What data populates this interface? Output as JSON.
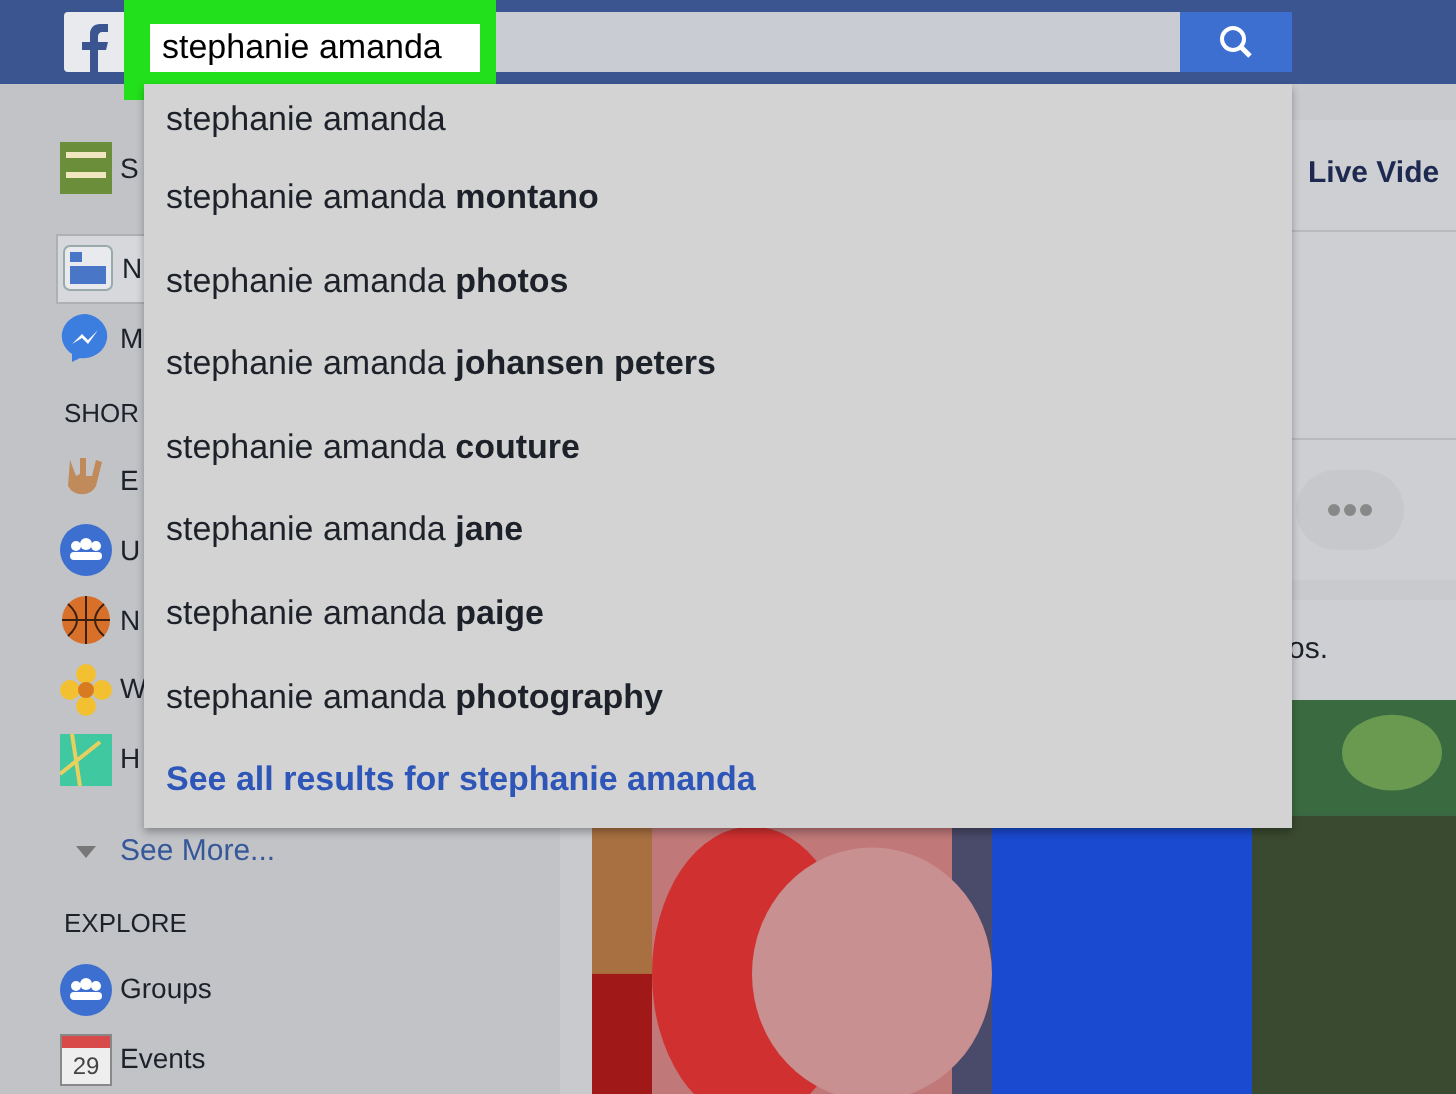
{
  "top_bar": {
    "search": {
      "value": "stephanie amanda"
    }
  },
  "suggestions": [
    {
      "text": "stephanie amanda"
    },
    {
      "text": "stephanie amanda **montano**"
    },
    {
      "text": "stephanie amanda **photos**"
    },
    {
      "text": "stephanie amanda **johansen peters**"
    },
    {
      "text": "stephanie amanda **couture**"
    },
    {
      "text": "stephanie amanda **jane**"
    },
    {
      "text": "stephanie amanda **paige**"
    },
    {
      "text": "stephanie amanda **photography**"
    }
  ],
  "see_all": "See all results for stephanie amanda",
  "sidebar": {
    "items": [
      {
        "kind": "item",
        "label": "S",
        "selected": false
      },
      {
        "kind": "item",
        "label": "N",
        "selected": true
      },
      {
        "kind": "item",
        "label": "M",
        "selected": false
      },
      {
        "kind": "heading",
        "label": "SHOR"
      },
      {
        "kind": "item",
        "label": "E",
        "selected": false
      },
      {
        "kind": "item",
        "label": "U",
        "selected": false
      },
      {
        "kind": "item",
        "label": "N",
        "selected": false
      },
      {
        "kind": "item",
        "label": "W",
        "selected": false
      },
      {
        "kind": "item",
        "label": "H",
        "selected": false
      },
      {
        "kind": "more",
        "label": "See More..."
      },
      {
        "kind": "heading",
        "label": "EXPLORE"
      },
      {
        "kind": "item",
        "label": "Groups",
        "selected": false
      },
      {
        "kind": "item",
        "label": "Events",
        "day": "29",
        "selected": false
      }
    ]
  },
  "composer": {
    "tab": "Live Vide"
  },
  "post": {
    "text": "os."
  }
}
